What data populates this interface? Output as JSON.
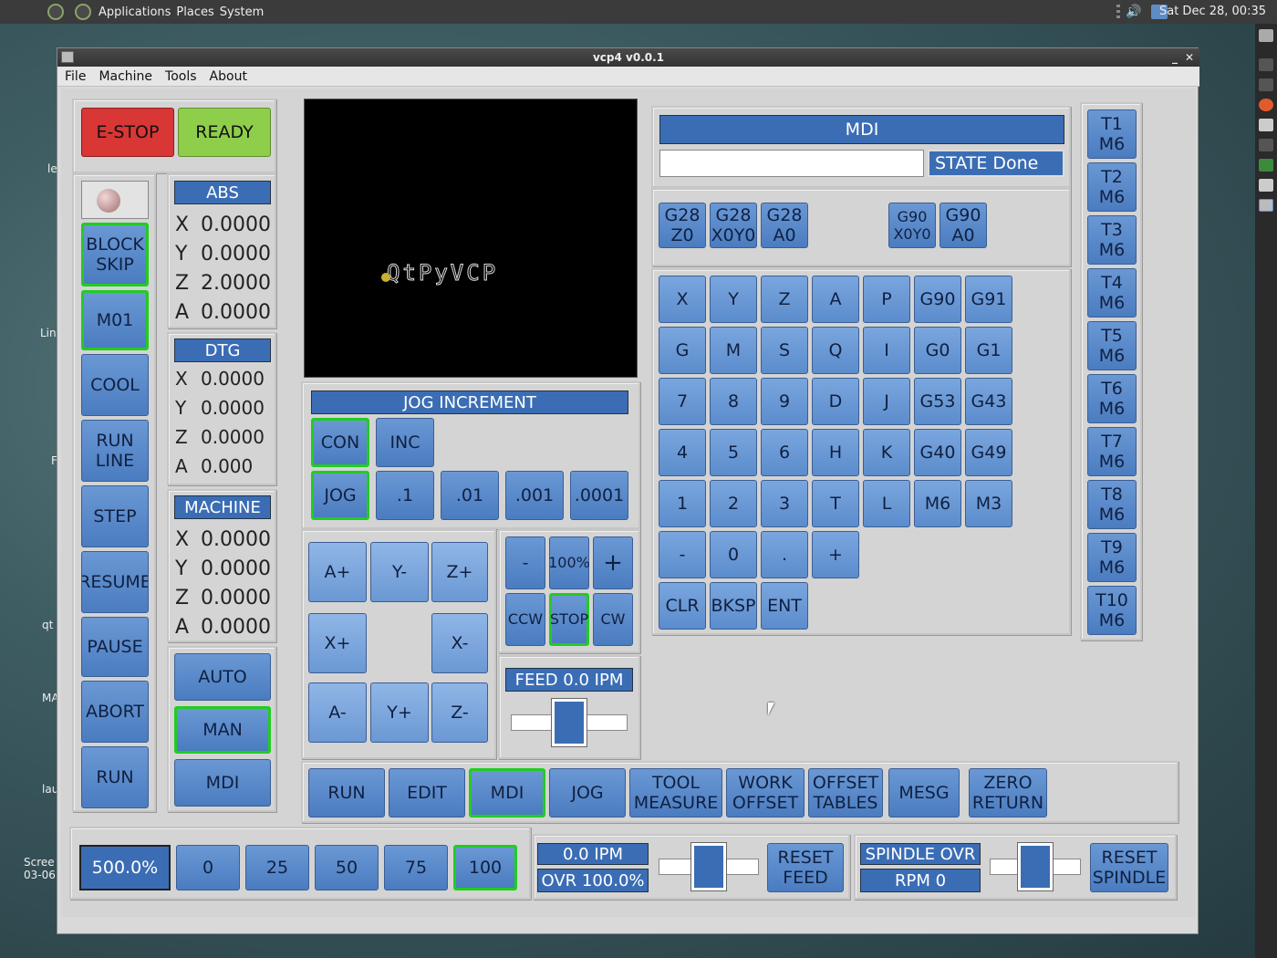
{
  "desktop": {
    "menus": [
      "Applications",
      "Places",
      "System"
    ],
    "clock": "Sat Dec 28, 00:35",
    "icon_labels": [
      "le",
      "Lin",
      "F",
      "qt",
      "MA",
      "lau",
      "Scree",
      "03-06"
    ]
  },
  "window": {
    "title": "vcp4 v0.0.1",
    "menu": [
      "File",
      "Machine",
      "Tools",
      "About"
    ]
  },
  "estop": {
    "estop": "E-STOP",
    "ready": "READY"
  },
  "side_buttons": {
    "block_skip": "BLOCK\nSKIP",
    "m01": "M01",
    "cool": "COOL",
    "run_line": "RUN\nLINE",
    "step": "STEP",
    "resume": "RESUME",
    "pause": "PAUSE",
    "abort": "ABORT",
    "run": "RUN"
  },
  "dro": {
    "abs": {
      "title": "ABS",
      "rows": [
        {
          "axis": "X",
          "value": "0.0000"
        },
        {
          "axis": "Y",
          "value": "0.0000"
        },
        {
          "axis": "Z",
          "value": "2.0000"
        },
        {
          "axis": "A",
          "value": "0.0000"
        }
      ]
    },
    "dtg": {
      "title": "DTG",
      "rows": [
        {
          "axis": "X",
          "value": "0.0000"
        },
        {
          "axis": "Y",
          "value": "0.0000"
        },
        {
          "axis": "Z",
          "value": "0.0000"
        },
        {
          "axis": "A",
          "value": "0.000"
        }
      ]
    },
    "machine": {
      "title": "MACHINE",
      "rows": [
        {
          "axis": "X",
          "value": "0.0000"
        },
        {
          "axis": "Y",
          "value": "0.0000"
        },
        {
          "axis": "Z",
          "value": "0.0000"
        },
        {
          "axis": "A",
          "value": "0.0000"
        }
      ]
    }
  },
  "modes": {
    "auto": "AUTO",
    "man": "MAN",
    "mdi": "MDI"
  },
  "preview": {
    "logo": "QtPyVCP"
  },
  "jog": {
    "title": "JOG INCREMENT",
    "con": "CON",
    "inc": "INC",
    "jog": "JOG",
    "incs": [
      ".1",
      ".01",
      ".001",
      ".0001"
    ],
    "axes": {
      "ap": "A+",
      "ym": "Y-",
      "zp": "Z+",
      "xp": "X+",
      "xm": "X-",
      "am": "A-",
      "yp": "Y+",
      "zm": "Z-"
    }
  },
  "spindle": {
    "minus": "-",
    "pct": "100%",
    "plus": "+",
    "ccw": "CCW",
    "stop": "STOP",
    "cw": "CW"
  },
  "feed": {
    "label": "FEED 0.0  IPM",
    "slider_level": 0.5
  },
  "mdi": {
    "title": "MDI",
    "input_value": "",
    "state": "STATE  Done",
    "gbtns": [
      {
        "l1": "G28",
        "l2": "Z0"
      },
      {
        "l1": "G28",
        "l2": "X0Y0"
      },
      {
        "l1": "G28",
        "l2": "A0"
      },
      {
        "l1": "G90",
        "l2": "X0Y0"
      },
      {
        "l1": "G90",
        "l2": "A0"
      }
    ],
    "keys": [
      [
        "X",
        "Y",
        "Z",
        "A",
        "P",
        "G90",
        "G91"
      ],
      [
        "G",
        "M",
        "S",
        "Q",
        "I",
        "G0",
        "G1"
      ],
      [
        "7",
        "8",
        "9",
        "D",
        "J",
        "G53",
        "G43"
      ],
      [
        "4",
        "5",
        "6",
        "H",
        "K",
        "G40",
        "G49"
      ],
      [
        "1",
        "2",
        "3",
        "T",
        "L",
        "M6",
        "M3"
      ],
      [
        "-",
        "0",
        ".",
        "+"
      ]
    ],
    "actions": [
      "CLR",
      "BKSP",
      "ENT"
    ]
  },
  "tools": [
    "T1\nM6",
    "T2\nM6",
    "T3\nM6",
    "T4\nM6",
    "T5\nM6",
    "T6\nM6",
    "T7\nM6",
    "T8\nM6",
    "T9\nM6",
    "T10\nM6"
  ],
  "tabs": [
    "RUN",
    "EDIT",
    "MDI",
    "JOG",
    "TOOL\nMEASURE",
    "WORK\nOFFSET",
    "OFFSET\nTABLES",
    "MESG",
    "ZERO\nRETURN"
  ],
  "bottom": {
    "rapid": "500.0%",
    "rapid_btns": [
      "0",
      "25",
      "50",
      "75",
      "100"
    ],
    "feed_ipm": "0.0  IPM",
    "feed_ovr": "OVR 100.0%",
    "reset_feed": "RESET\nFEED",
    "spindle_ovr": "SPINDLE OVR",
    "rpm": "RPM 0",
    "reset_spindle": "RESET\nSPINDLE",
    "feed_slider_level": 0.5,
    "spindle_slider_level": 0.5
  },
  "colors": {
    "button": "#5a8ccc",
    "label": "#3b6db5",
    "estop": "#d93636",
    "ready": "#8fce4a",
    "selected": "#22cc22"
  }
}
